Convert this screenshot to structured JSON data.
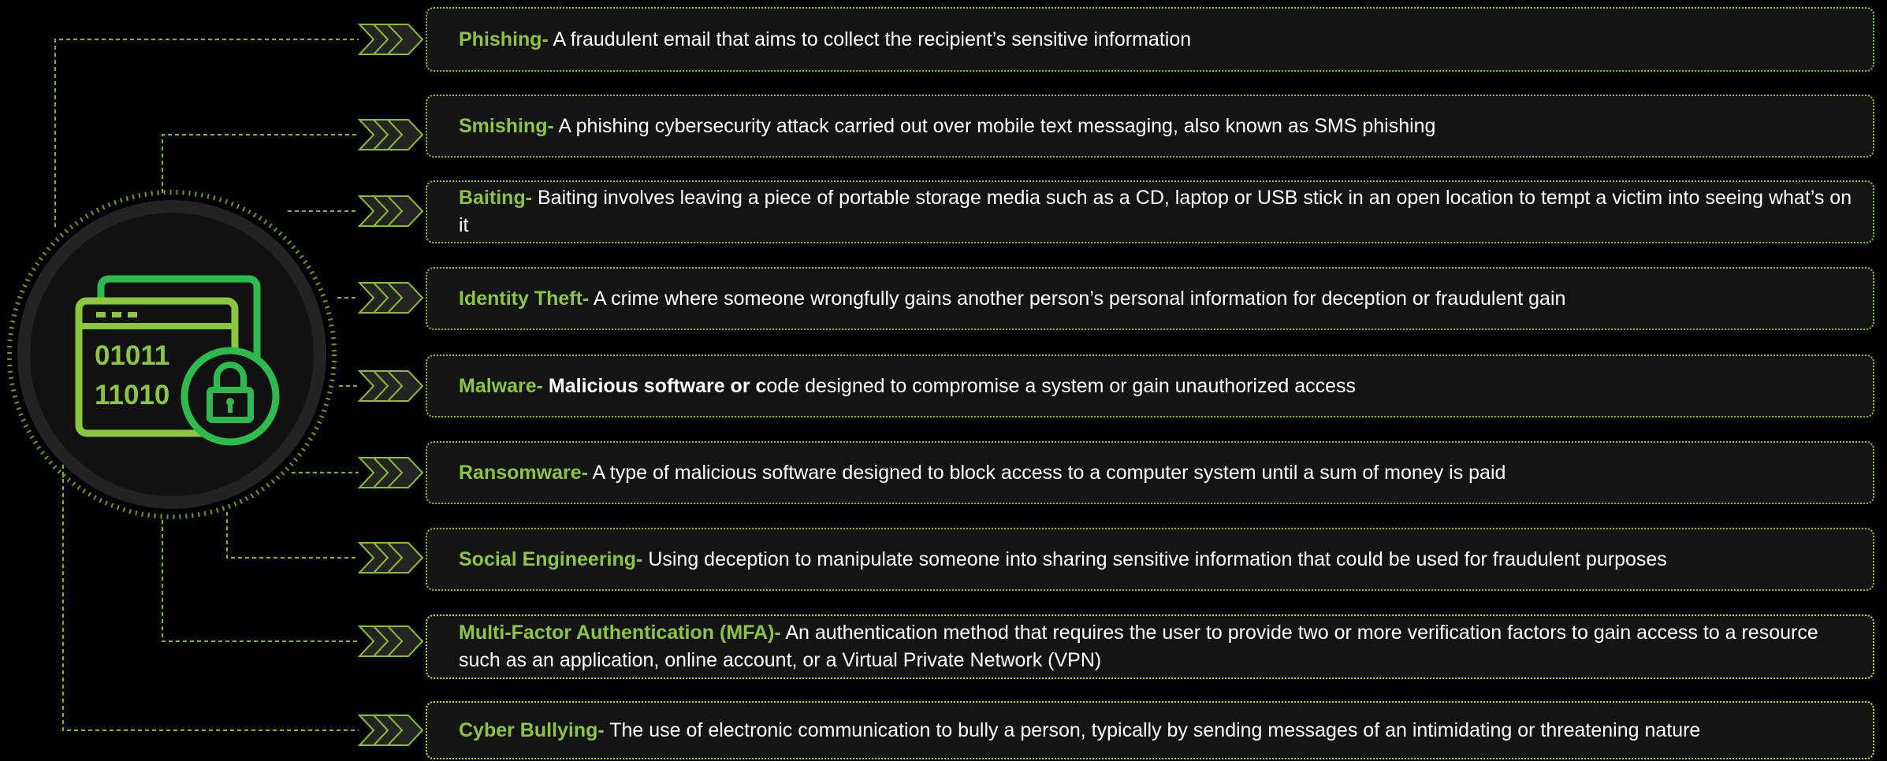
{
  "colors": {
    "background": "#000000",
    "accent_green": "#8cc63f",
    "bright_green": "#2dbb4e",
    "box_fill": "#141414",
    "box_border": "#8cbf26",
    "wire": "#7fb81c"
  },
  "hub": {
    "icon_names": [
      "browser-window-icon",
      "binary-code-icon",
      "padlock-icon"
    ],
    "binary_line_1": "01011",
    "binary_line_2": "11010"
  },
  "items": [
    {
      "term": "Phishing-",
      "def_bold": "",
      "definition": " A fraudulent email that aims to collect the recipient’s sensitive information"
    },
    {
      "term": "Smishing-",
      "def_bold": "",
      "definition": " A phishing cybersecurity attack carried out over mobile text messaging, also known as SMS phishing"
    },
    {
      "term": "Baiting-",
      "def_bold": "",
      "definition": " Baiting involves leaving a piece of portable storage media such as a CD, laptop or USB stick in an open location to tempt a victim into seeing what’s on it"
    },
    {
      "term": "Identity Theft-",
      "def_bold": "",
      "definition": " A crime where someone wrongfully gains another person’s personal information for deception or fraudulent gain"
    },
    {
      "term": "Malware-",
      "def_bold": " Malicious software or c",
      "definition": "ode designed to compromise a system or gain unauthorized access"
    },
    {
      "term": "Ransomware-",
      "def_bold": "",
      "definition": " A type of malicious software designed to block access to a computer system until a sum of money is paid"
    },
    {
      "term": "Social Engineering-",
      "def_bold": "",
      "definition": " Using deception to manipulate someone into sharing sensitive information that could be used for fraudulent purposes"
    },
    {
      "term": "Multi-Factor Authentication (MFA)-",
      "def_bold": "",
      "definition": " An authentication method that requires the user to provide two or more verification factors to gain access to a resource such as an application, online account, or a Virtual Private Network (VPN)"
    },
    {
      "term": "Cyber Bullying-",
      "def_bold": "",
      "definition": " The use of electronic communication to bully a person, typically by sending messages of an intimidating or threatening nature"
    }
  ]
}
